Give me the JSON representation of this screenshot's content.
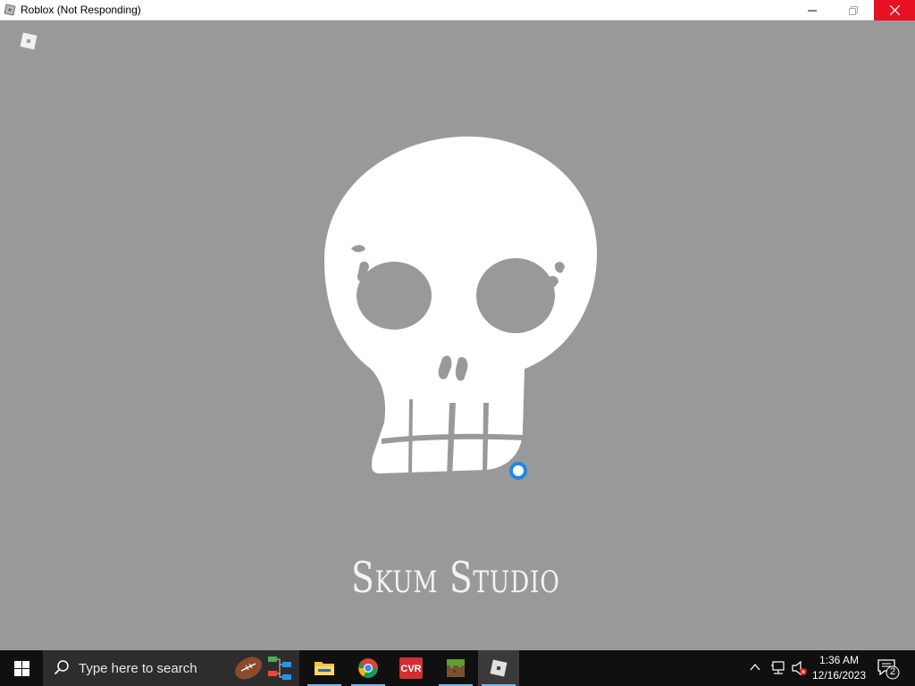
{
  "window": {
    "title": "Roblox (Not Responding)",
    "app_icon": "roblox-icon",
    "controls": [
      "minimize-icon",
      "maximize-icon",
      "close-icon"
    ]
  },
  "splash": {
    "studio_name": "Skum Studio",
    "logo": "skull-logo",
    "corner_icon": "roblox-logo-icon",
    "loading_indicator": "spinner-icon"
  },
  "taskbar": {
    "start_icon": "windows-start-icon",
    "search_placeholder": "Type here to search",
    "pinned_apps": [
      {
        "name": "file-explorer",
        "icon": "folder-icon"
      },
      {
        "name": "chrome",
        "icon": "chrome-icon"
      },
      {
        "name": "cyberlink",
        "icon": "media-app-icon"
      },
      {
        "name": "minecraft",
        "icon": "grass-block-icon"
      },
      {
        "name": "roblox",
        "icon": "roblox-icon"
      }
    ],
    "tray_icons": [
      "chevron-up-icon",
      "network-icon",
      "volume-muted-icon"
    ],
    "time": "1:36 AM",
    "date": "12/16/2023",
    "notification_count": "2"
  },
  "colors": {
    "background": "#999999",
    "taskbar": "#101010",
    "close_button": "#e81123",
    "accent": "#0078d7"
  }
}
